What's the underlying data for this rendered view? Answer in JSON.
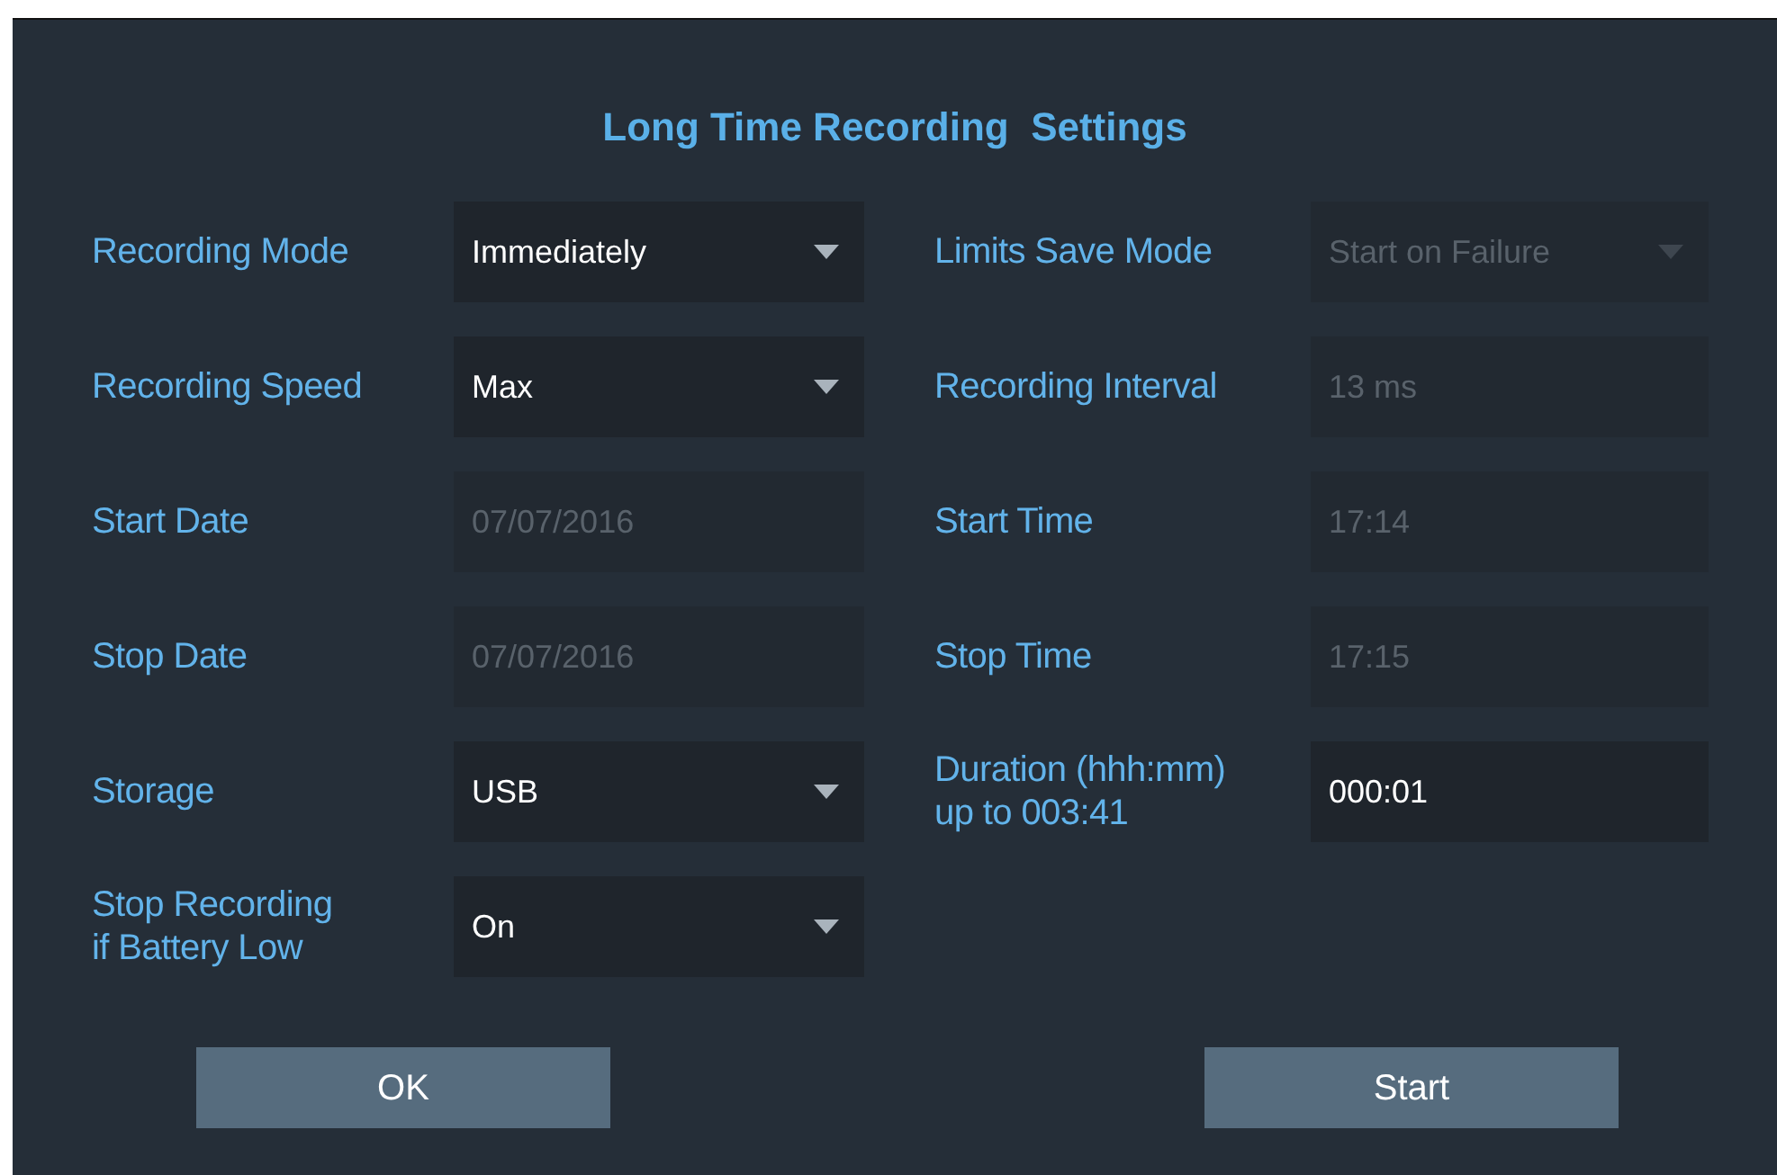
{
  "dialog": {
    "title": "Long Time Recording  Settings"
  },
  "rows": [
    {
      "left": {
        "label": "Recording Mode",
        "kind": "dropdown",
        "value": "Immediately",
        "disabled": false
      },
      "right": {
        "label": "Limits Save Mode",
        "kind": "dropdown",
        "value": "Start on Failure",
        "disabled": true
      }
    },
    {
      "left": {
        "label": "Recording Speed",
        "kind": "dropdown",
        "value": "Max",
        "disabled": false
      },
      "right": {
        "label": "Recording Interval",
        "kind": "text",
        "value": "13 ms",
        "disabled": true
      }
    },
    {
      "left": {
        "label": "Start Date",
        "kind": "text",
        "value": "07/07/2016",
        "disabled": true
      },
      "right": {
        "label": "Start Time",
        "kind": "text",
        "value": "17:14",
        "disabled": true
      }
    },
    {
      "left": {
        "label": "Stop Date",
        "kind": "text",
        "value": "07/07/2016",
        "disabled": true
      },
      "right": {
        "label": "Stop Time",
        "kind": "text",
        "value": "17:15",
        "disabled": true
      }
    },
    {
      "left": {
        "label": "Storage",
        "kind": "dropdown",
        "value": "USB",
        "disabled": false
      },
      "right": {
        "label": "Duration (hhh:mm)\nup to 003:41",
        "kind": "text",
        "value": "000:01",
        "disabled": false
      }
    },
    {
      "left": {
        "label": "Stop Recording\nif Battery Low",
        "kind": "dropdown",
        "value": "On",
        "disabled": false
      }
    }
  ],
  "buttons": [
    "OK",
    "Start"
  ]
}
